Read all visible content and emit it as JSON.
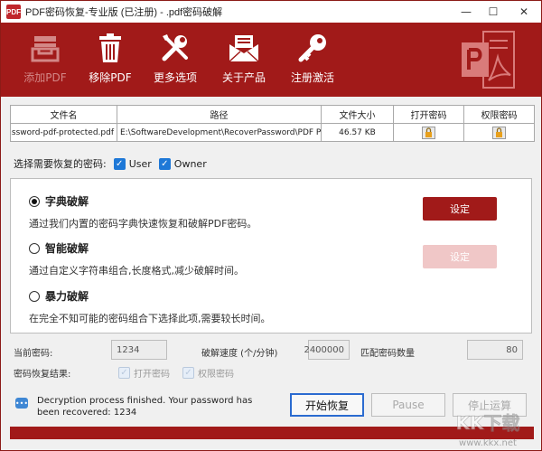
{
  "window": {
    "title": "PDF密码恢复-专业版 (已注册) - .pdf密码破解",
    "app_icon_text": "PDF",
    "controls": [
      "—",
      "☐",
      "✕"
    ]
  },
  "toolbar": {
    "items": [
      {
        "label": "添加PDF",
        "icon": "tray-add-icon",
        "enabled": false
      },
      {
        "label": "移除PDF",
        "icon": "trash-icon",
        "enabled": true
      },
      {
        "label": "更多选项",
        "icon": "tools-icon",
        "enabled": true
      },
      {
        "label": "关于产品",
        "icon": "envelope-icon",
        "enabled": true
      },
      {
        "label": "注册激活",
        "icon": "key-icon",
        "enabled": true
      }
    ],
    "brand_color": "#a11a19"
  },
  "file_table": {
    "headers": [
      "文件名",
      "路径",
      "文件大小",
      "打开密码",
      "权限密码"
    ],
    "rows": [
      {
        "filename": "password-pdf-protected.pdf",
        "path": "E:\\SoftwareDevelopment\\RecoverPassword\\PDF Pass",
        "size": "46.57 KB",
        "open_password": "lock-icon",
        "permission_password": "lock-icon"
      }
    ]
  },
  "password_select": {
    "label": "选择需要恢复的密码:",
    "options": [
      {
        "label": "User",
        "checked": true
      },
      {
        "label": "Owner",
        "checked": true
      }
    ]
  },
  "attacks": [
    {
      "title": "字典破解",
      "desc": "通过我们内置的密码字典快速恢复和破解PDF密码。",
      "selected": true,
      "button": "设定",
      "button_enabled": true
    },
    {
      "title": "智能破解",
      "desc": "通过自定义字符串组合,长度格式,减少破解时间。",
      "selected": false,
      "button": "设定",
      "button_enabled": false
    },
    {
      "title": "暴力破解",
      "desc": "在完全不知可能的密码组合下选择此项,需要较长时间。",
      "selected": false
    }
  ],
  "stats": {
    "current_password_label": "当前密码:",
    "current_password": "1234",
    "speed_label": "破解速度 (个/分钟)",
    "speed": "2400000",
    "matched_label": "匹配密码数量",
    "matched": "80"
  },
  "result": {
    "label": "密码恢复结果:",
    "open_label": "打开密码",
    "permission_label": "权限密码"
  },
  "status": {
    "message": "Decryption process finished. Your password has been recovered: 1234"
  },
  "buttons": {
    "start": "开始恢复",
    "pause": "Pause",
    "stop": "停止运算"
  },
  "watermark": {
    "brand": "KK下载",
    "url": "www.kkx.net"
  }
}
